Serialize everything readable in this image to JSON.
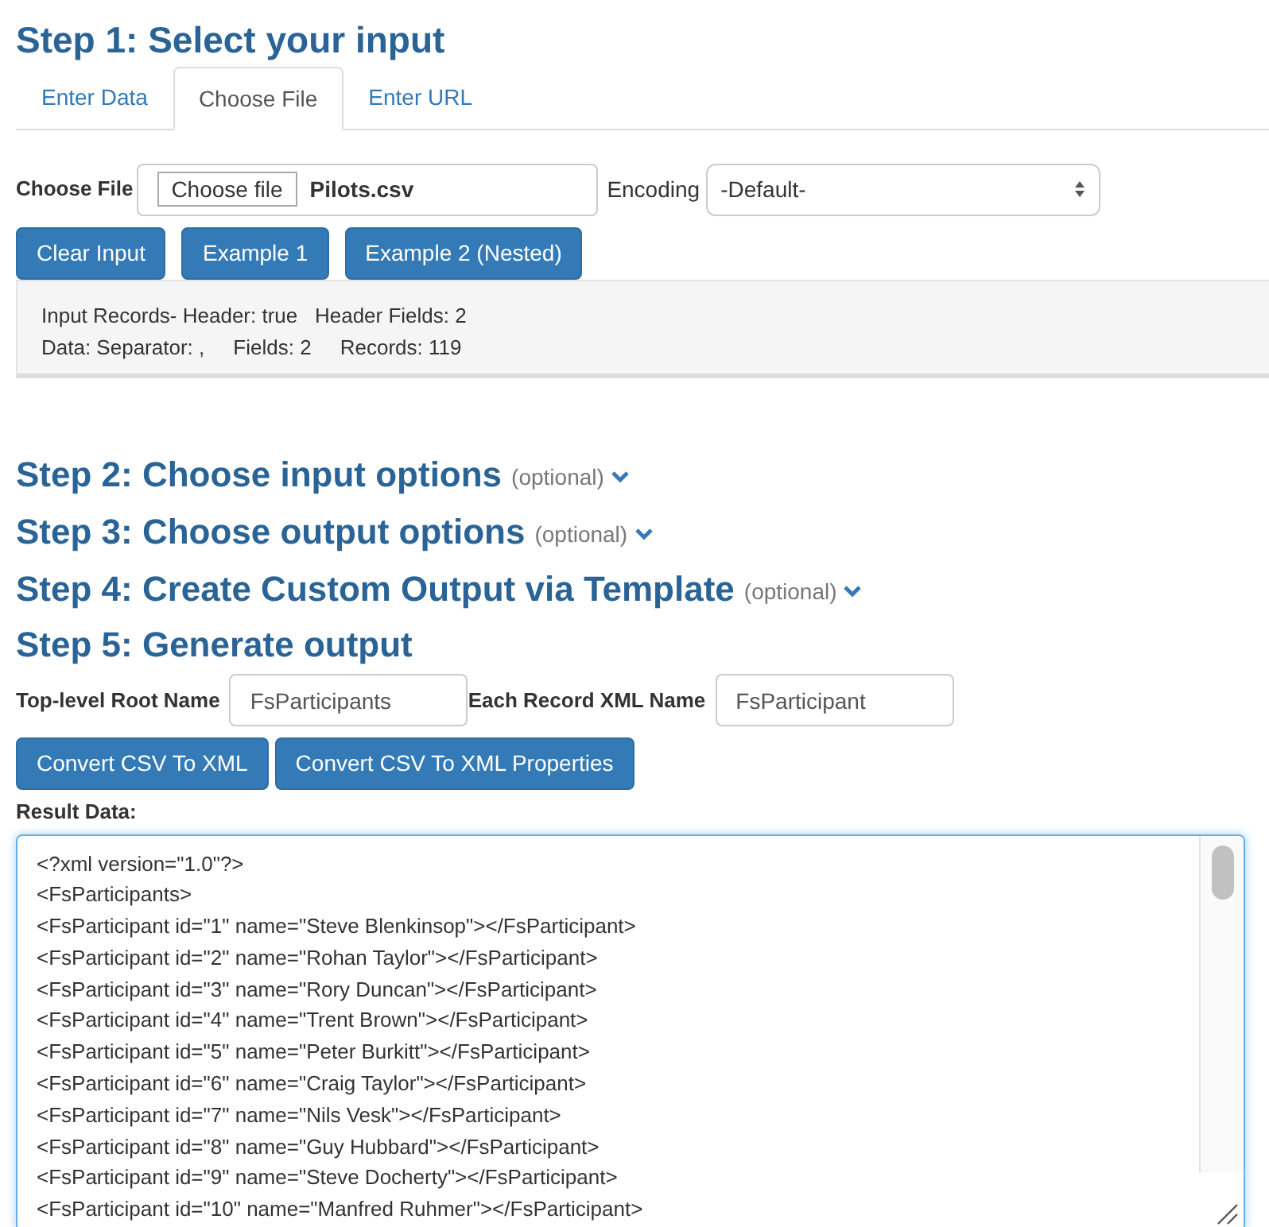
{
  "step1": {
    "title": "Step 1: Select your input"
  },
  "tabs": [
    {
      "label": "Enter Data",
      "selected": false
    },
    {
      "label": "Choose File",
      "selected": true
    },
    {
      "label": "Enter URL",
      "selected": false
    }
  ],
  "file_row": {
    "label": "Choose File",
    "button": "Choose file",
    "file_name": "Pilots.csv",
    "encoding_label": "Encoding",
    "encoding_value": "-Default-"
  },
  "input_buttons": [
    "Clear Input",
    "Example 1",
    "Example 2 (Nested)"
  ],
  "info_lines": [
    "Input Records- Header: true   Header Fields: 2",
    "Data: Separator: ,     Fields: 2     Records: 119"
  ],
  "optional_steps": [
    {
      "title": "Step 2: Choose input options",
      "note": "(optional)"
    },
    {
      "title": "Step 3: Choose output options",
      "note": "(optional)"
    },
    {
      "title": "Step 4: Create Custom Output via Template",
      "note": "(optional)"
    }
  ],
  "step5": {
    "title": "Step 5: Generate output"
  },
  "names": [
    {
      "label": "Top-level Root Name",
      "value": "FsParticipants"
    },
    {
      "label": "Each Record XML Name",
      "value": "FsParticipant"
    }
  ],
  "convert_buttons": [
    "Convert CSV To XML",
    "Convert CSV To XML Properties"
  ],
  "result": {
    "label": "Result Data:",
    "lines": [
      "<?xml version=\"1.0\"?>",
      "<FsParticipants>",
      "<FsParticipant id=\"1\" name=\"Steve Blenkinsop\"></FsParticipant>",
      "<FsParticipant id=\"2\" name=\"Rohan Taylor\"></FsParticipant>",
      "<FsParticipant id=\"3\" name=\"Rory Duncan\"></FsParticipant>",
      "<FsParticipant id=\"4\" name=\"Trent Brown\"></FsParticipant>",
      "<FsParticipant id=\"5\" name=\"Peter Burkitt\"></FsParticipant>",
      "<FsParticipant id=\"6\" name=\"Craig Taylor\"></FsParticipant>",
      "<FsParticipant id=\"7\" name=\"Nils Vesk\"></FsParticipant>",
      "<FsParticipant id=\"8\" name=\"Guy Hubbard\"></FsParticipant>",
      "<FsParticipant id=\"9\" name=\"Steve Docherty\"></FsParticipant>",
      "<FsParticipant id=\"10\" name=\"Manfred Ruhmer\"></FsParticipant>"
    ]
  }
}
